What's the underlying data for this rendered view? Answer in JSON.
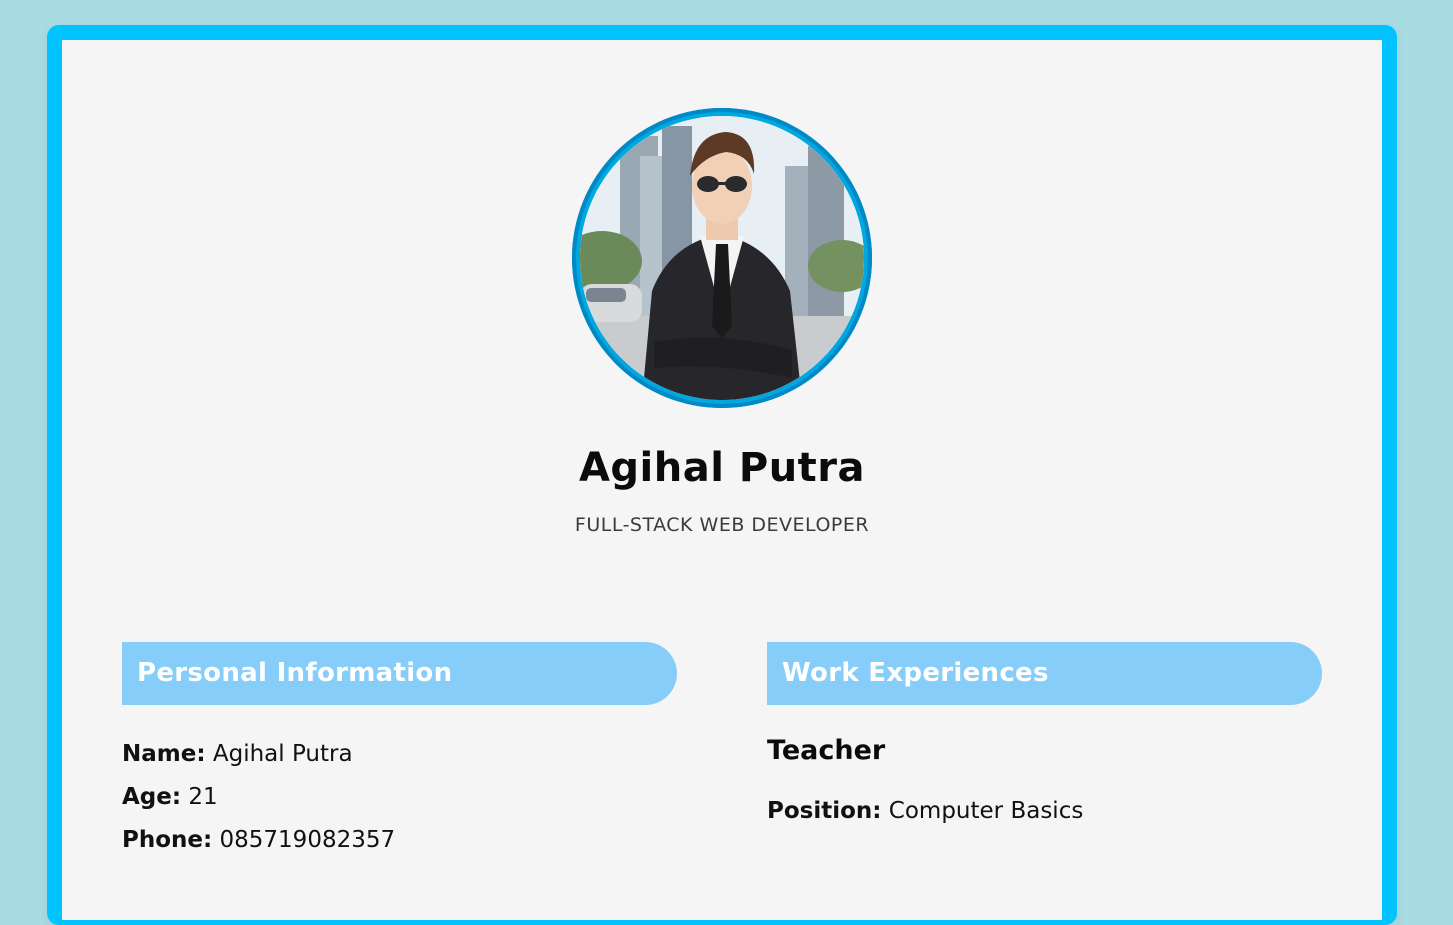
{
  "profile": {
    "name": "Agihal Putra",
    "role": "FULL-STACK WEB DEVELOPER",
    "photo_icon": "profile-photo"
  },
  "personal": {
    "header": "Personal Information",
    "fields": [
      {
        "label": "Name:",
        "value": "Agihal Putra"
      },
      {
        "label": "Age:",
        "value": "21"
      },
      {
        "label": "Phone:",
        "value": "085719082357"
      }
    ]
  },
  "work": {
    "header": "Work Experiences",
    "jobs": [
      {
        "title": "Teacher",
        "position_label": "Position:",
        "position_value": "Computer Basics"
      }
    ]
  },
  "colors": {
    "background": "#a9dbe3",
    "frame": "#00c3ff",
    "card": "#f5f5f5",
    "section_header": "#87cdf9",
    "avatar_ring": "#00a8e0"
  }
}
